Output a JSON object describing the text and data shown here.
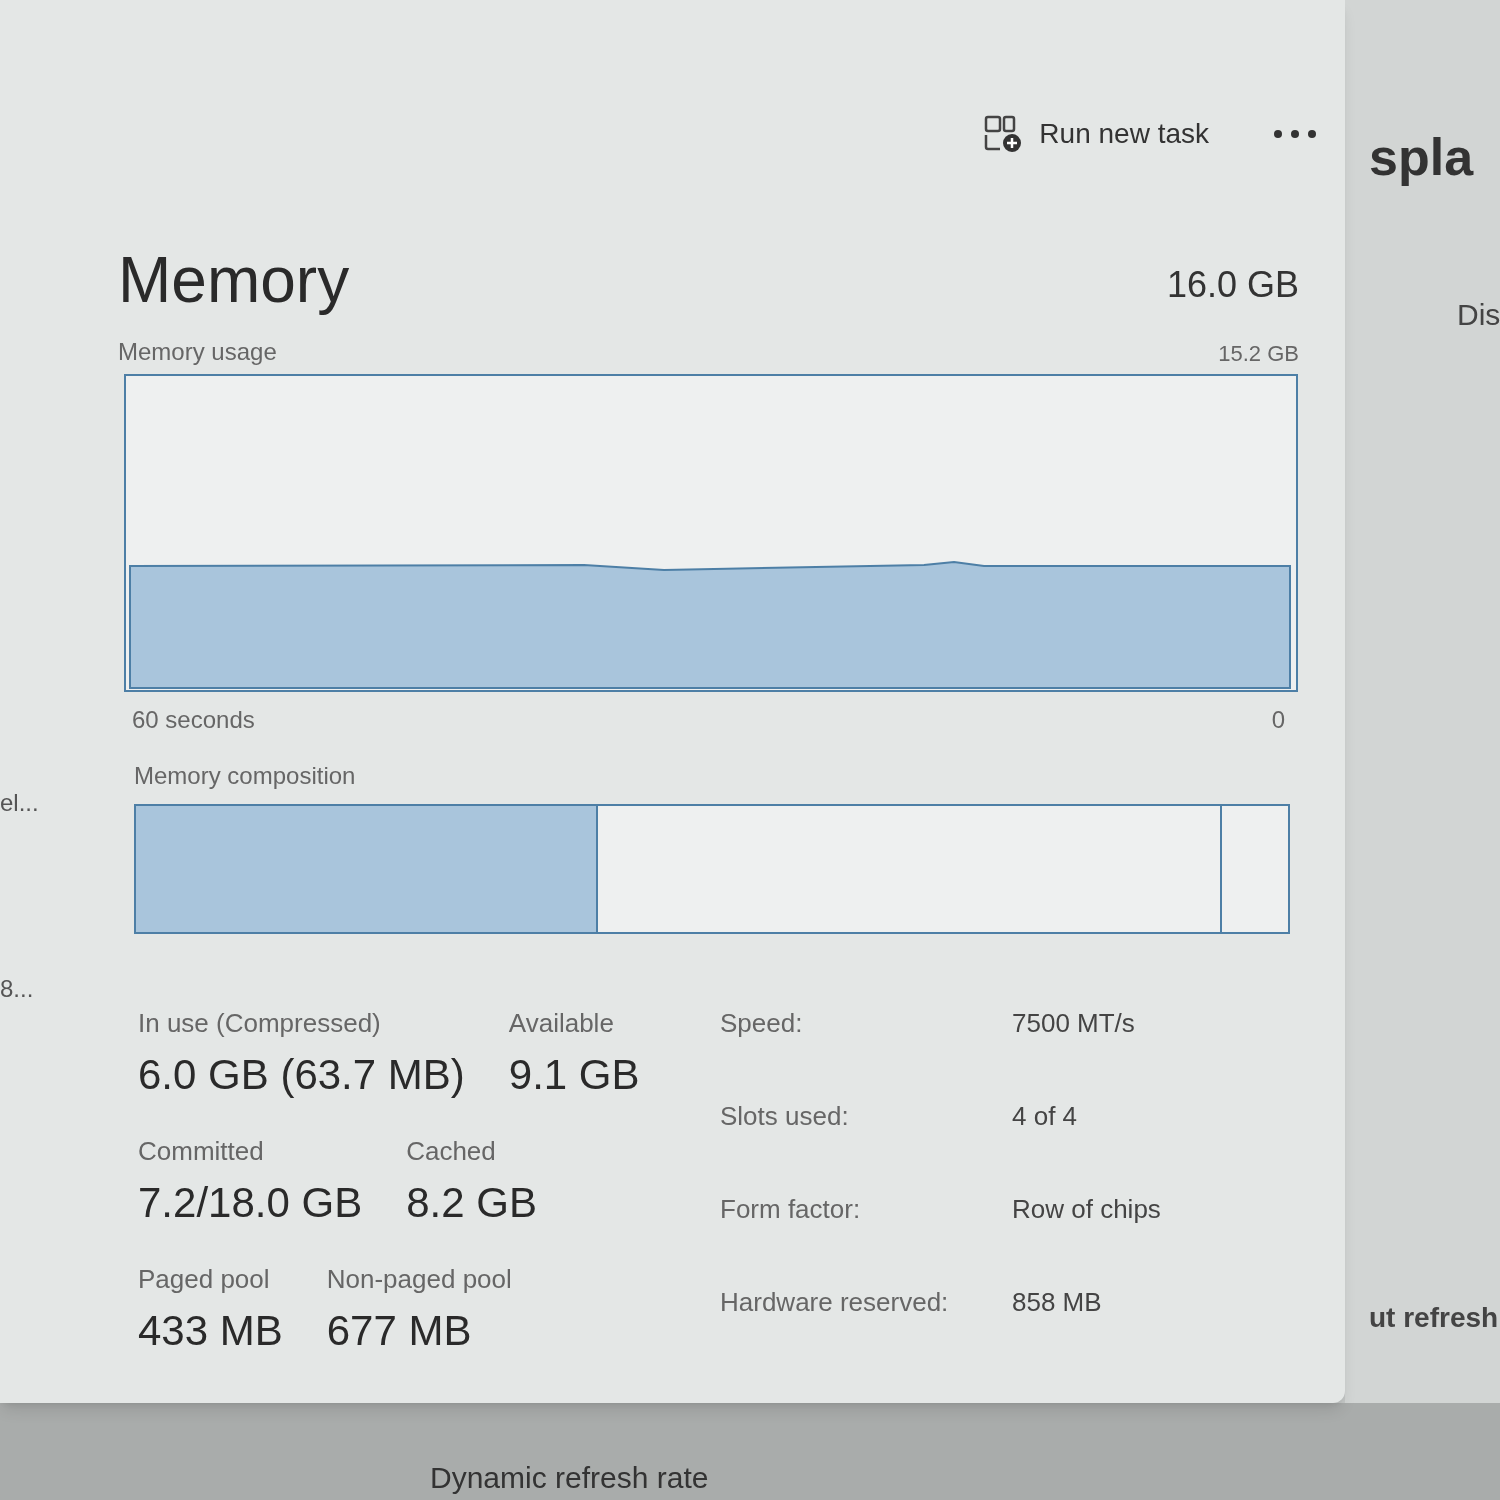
{
  "left_edge": [
    "el...",
    "8..."
  ],
  "toolbar": {
    "run_new_task": "Run new task"
  },
  "memory": {
    "title": "Memory",
    "total": "16.0 GB",
    "usage_label": "Memory usage",
    "usage_max": "15.2 GB",
    "time_span": "60 seconds",
    "time_end": "0",
    "composition_label": "Memory composition",
    "stat_rows": [
      [
        {
          "label": "In use (Compressed)",
          "value": "6.0 GB (63.7 MB)"
        },
        {
          "label": "Available",
          "value": "9.1 GB"
        }
      ],
      [
        {
          "label": "Committed",
          "value": "7.2/18.0 GB"
        },
        {
          "label": "Cached",
          "value": "8.2 GB"
        }
      ],
      [
        {
          "label": "Paged pool",
          "value": "433 MB"
        },
        {
          "label": "Non-paged pool",
          "value": "677 MB"
        }
      ]
    ],
    "properties": [
      {
        "label": "Speed:",
        "value": "7500 MT/s"
      },
      {
        "label": "Slots used:",
        "value": "4 of 4"
      },
      {
        "label": "Form factor:",
        "value": "Row of chips"
      },
      {
        "label": "Hardware reserved:",
        "value": "858 MB"
      }
    ]
  },
  "background_window": {
    "title": "spla",
    "tab": "Dis",
    "setting": "ut refresh",
    "bottom_setting": "Dynamic refresh rate"
  }
}
